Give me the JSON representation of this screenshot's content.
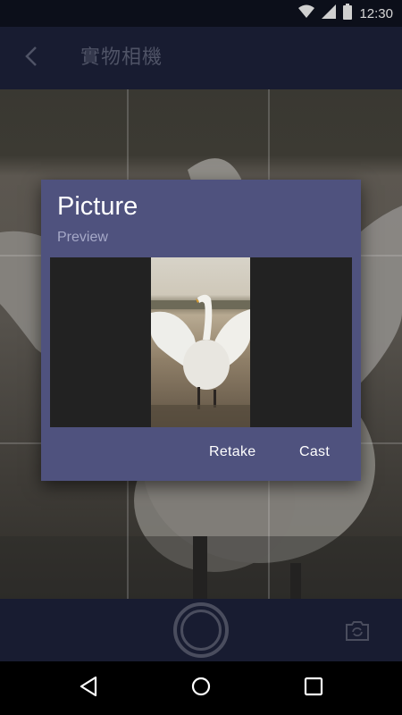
{
  "status_bar": {
    "time": "12:30",
    "icons": [
      "wifi-icon",
      "signal-icon",
      "battery-icon"
    ]
  },
  "app_bar": {
    "back_icon": "back-arrow-icon",
    "title": "實物相機"
  },
  "dialog": {
    "title": "Picture",
    "subtitle": "Preview",
    "buttons": {
      "retake": "Retake",
      "cast": "Cast"
    }
  },
  "controls": {
    "shutter_icon": "shutter-icon",
    "switch_camera_icon": "switch-camera-icon"
  },
  "nav_bar": {
    "icons": [
      "back-icon",
      "home-icon",
      "recents-icon"
    ]
  },
  "colors": {
    "dialog_bg": "#4f527e",
    "app_bar_bg": "#181c31",
    "status_bar_bg": "#0c0f1a"
  }
}
